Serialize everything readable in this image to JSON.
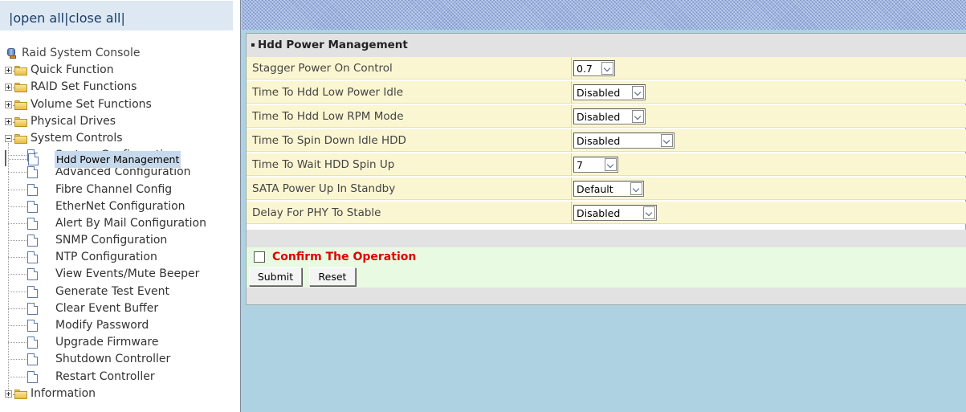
{
  "topbar": {
    "text": "|open all|close all|",
    "open_all": "open all",
    "close_all": "close all"
  },
  "tree": {
    "root_label": "Raid System Console",
    "folders": [
      {
        "label": "Quick Function",
        "expanded": false
      },
      {
        "label": "RAID Set Functions",
        "expanded": false
      },
      {
        "label": "Volume Set Functions",
        "expanded": false
      },
      {
        "label": "Physical Drives",
        "expanded": false
      },
      {
        "label": "System Controls",
        "expanded": true
      },
      {
        "label": "Information",
        "expanded": false
      }
    ],
    "system_controls_items": [
      "System Configuration",
      "Advanced Configuration",
      "Hdd Power Management",
      "Fibre Channel Config",
      "EtherNet Configuration",
      "Alert By Mail Configuration",
      "SNMP Configuration",
      "NTP Configuration",
      "View Events/Mute Beeper",
      "Generate Test Event",
      "Clear Event Buffer",
      "Modify Password",
      "Upgrade Firmware",
      "Shutdown Controller",
      "Restart Controller"
    ],
    "selected_item": "Hdd Power Management"
  },
  "panel": {
    "title": "Hdd Power Management",
    "fields": [
      {
        "label": "Stagger Power On Control",
        "value": "0.7"
      },
      {
        "label": "Time To Hdd Low Power Idle",
        "value": "Disabled"
      },
      {
        "label": "Time To Hdd Low RPM Mode",
        "value": "Disabled"
      },
      {
        "label": "Time To Spin Down Idle HDD",
        "value": "Disabled"
      },
      {
        "label": "Time To Wait HDD Spin Up",
        "value": "7"
      },
      {
        "label": "SATA Power Up In Standby",
        "value": "Default"
      },
      {
        "label": "Delay For PHY To Stable",
        "value": "Disabled"
      }
    ],
    "confirm_label": "Confirm The Operation",
    "confirm_checked": false,
    "submit_label": "Submit",
    "reset_label": "Reset"
  },
  "colors": {
    "confirm_text": "#e00000",
    "field_row_bg": "#fbf6d2",
    "content_bg": "#aed2e2",
    "tree_selected_bg": "#c7d9ec"
  }
}
